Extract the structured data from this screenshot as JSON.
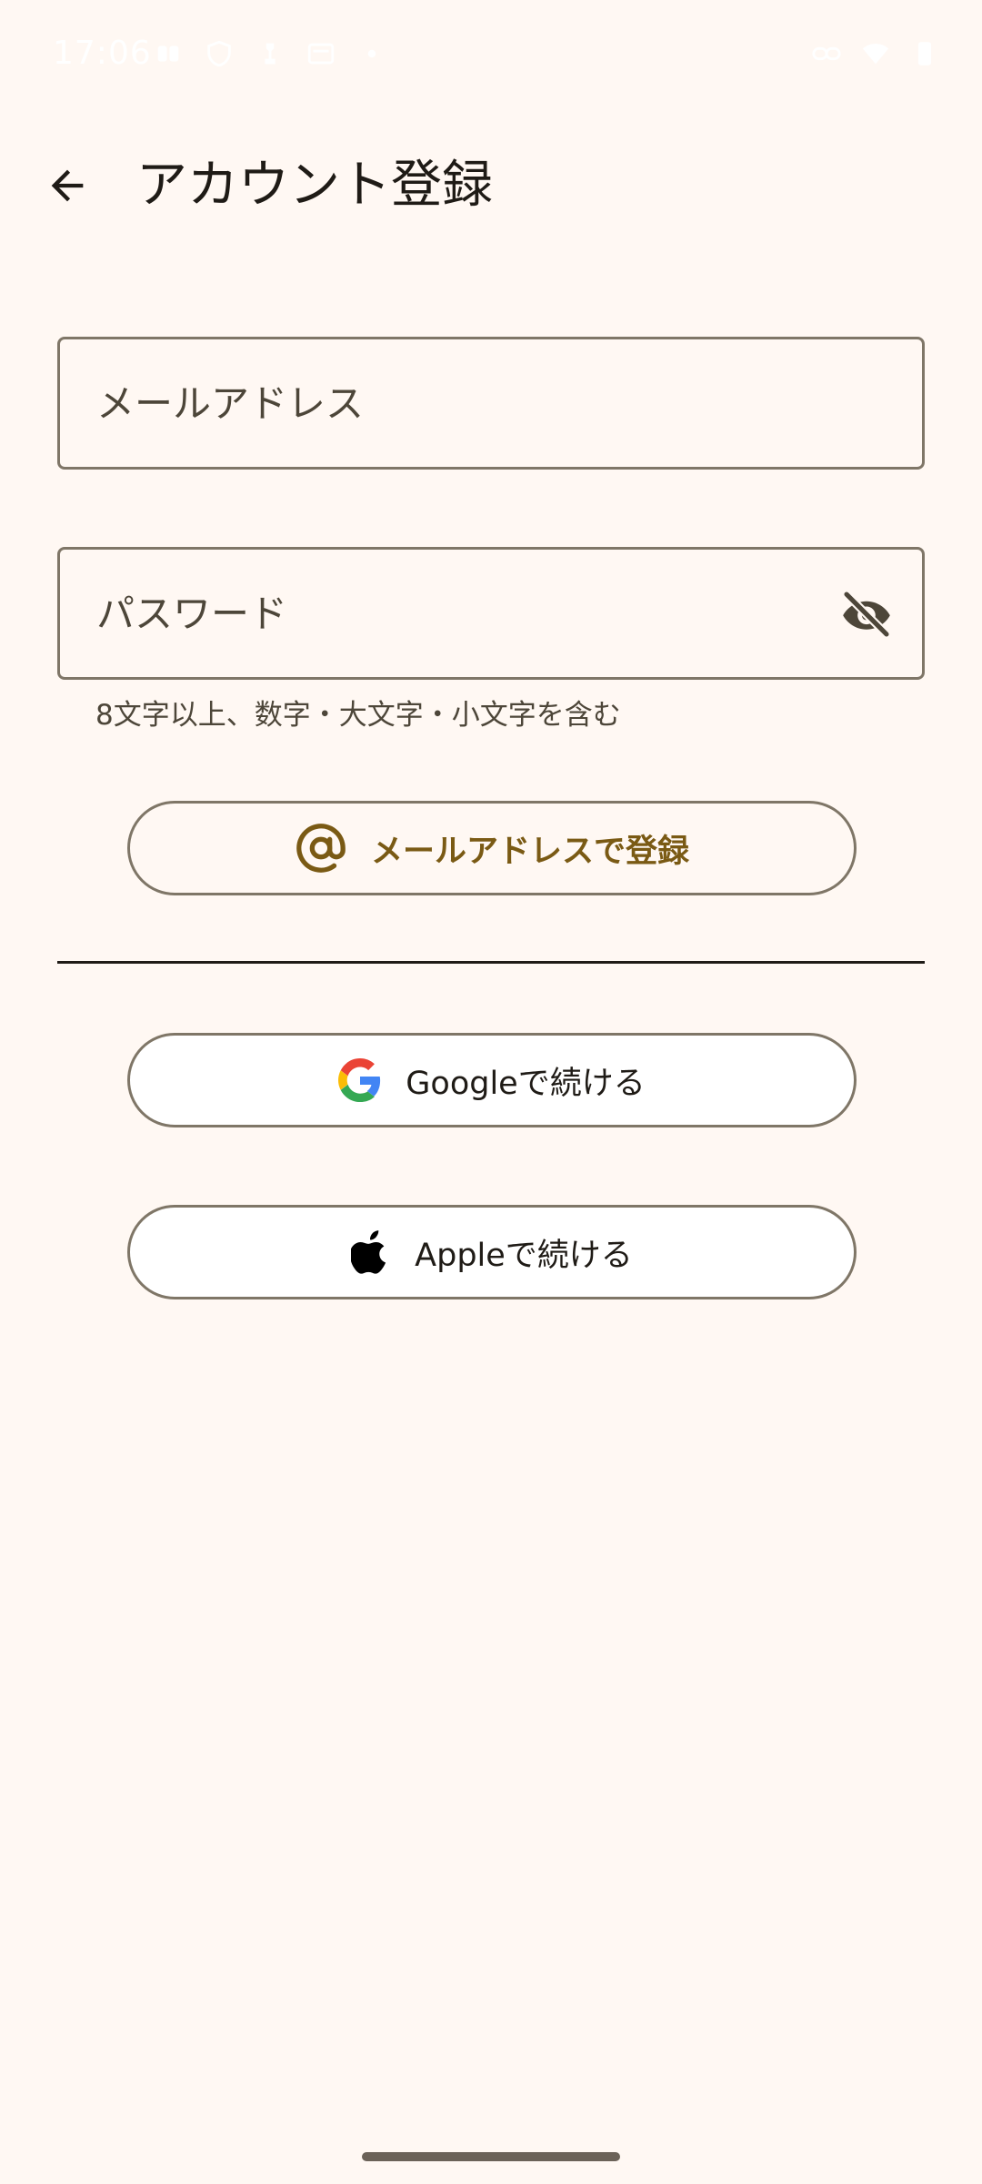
{
  "status_bar": {
    "time": "17:06",
    "left_icons": [
      "notification-icon",
      "shield-icon",
      "chess-icon",
      "message-icon",
      "dot-icon"
    ],
    "right_icons": [
      "link-icon",
      "wifi-icon",
      "battery-icon"
    ]
  },
  "app_bar": {
    "back_icon": "arrow-back-icon",
    "title": "アカウント登録"
  },
  "form": {
    "email": {
      "placeholder": "メールアドレス",
      "value": ""
    },
    "password": {
      "placeholder": "パスワード",
      "value": "",
      "toggle_icon": "visibility-off-icon",
      "helper": "8文字以上、数字・大文字・小文字を含む"
    },
    "email_signup": {
      "icon": "at-sign-icon",
      "label": "メールアドレスで登録"
    }
  },
  "social": {
    "google": {
      "icon": "google-logo-icon",
      "label": "Googleで続ける"
    },
    "apple": {
      "icon": "apple-logo-icon",
      "label": "Appleで続ける"
    }
  },
  "colors": {
    "background": "#FFF8F3",
    "outline": "#7F7667",
    "primary": "#7A5A14",
    "on_surface": "#1F1B16",
    "on_surface_variant": "#4D4639"
  }
}
